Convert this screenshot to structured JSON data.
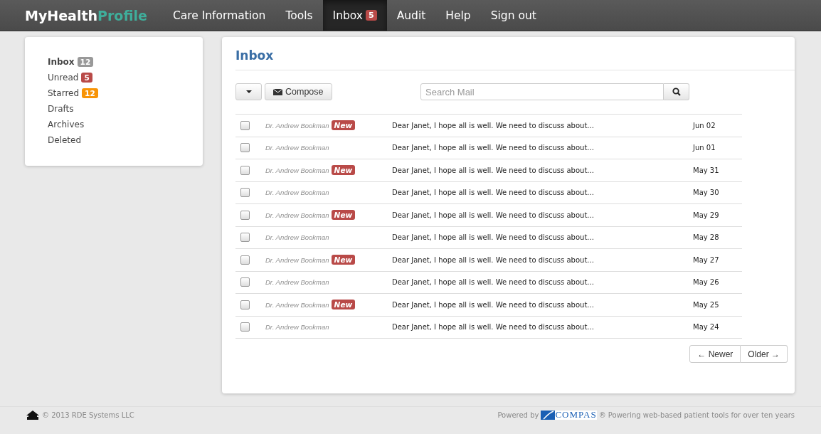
{
  "navbar": {
    "brand": {
      "first": "MyHealth",
      "second": "Profile"
    },
    "items": [
      {
        "label": "Care Information",
        "selected": false
      },
      {
        "label": "Tools",
        "selected": false
      },
      {
        "label": "Inbox",
        "badge": "5",
        "selected": true
      },
      {
        "label": "Audit",
        "selected": false
      },
      {
        "label": "Help",
        "selected": false
      },
      {
        "label": "Sign out",
        "selected": false
      }
    ]
  },
  "sidebar": {
    "items": [
      {
        "label": "Inbox",
        "badge": "12",
        "color": "#999999",
        "selected": true
      },
      {
        "label": "Unread",
        "badge": "5",
        "color": "#b94a48",
        "selected": false
      },
      {
        "label": "Starred",
        "badge": "12",
        "color": "#f89406",
        "selected": false
      },
      {
        "label": "Drafts",
        "selected": false
      },
      {
        "label": "Archives",
        "selected": false
      },
      {
        "label": "Deleted",
        "selected": false
      }
    ]
  },
  "inbox": {
    "title": "Inbox",
    "compose": "Compose",
    "search": {
      "placeholder": "Search Mail"
    },
    "messages": [
      {
        "sender": "Dr. Andrew Bookman",
        "new": true,
        "badge": "New",
        "subject": "Dear Janet, I hope all is well. We need to discuss about...",
        "date": "Jun 02",
        "checked": false
      },
      {
        "sender": "Dr. Andrew Bookman",
        "new": false,
        "subject": "Dear Janet, I hope all is well. We need to discuss about...",
        "date": "Jun 01",
        "checked": false
      },
      {
        "sender": "Dr. Andrew Bookman",
        "new": true,
        "badge": "New",
        "subject": "Dear Janet, I hope all is well. We need to discuss about...",
        "date": "May 31",
        "checked": false
      },
      {
        "sender": "Dr. Andrew Bookman",
        "new": false,
        "subject": "Dear Janet, I hope all is well. We need to discuss about...",
        "date": "May 30",
        "checked": false
      },
      {
        "sender": "Dr. Andrew Bookman",
        "new": true,
        "badge": "New",
        "subject": "Dear Janet, I hope all is well. We need to discuss about...",
        "date": "May 29",
        "checked": false
      },
      {
        "sender": "Dr. Andrew Bookman",
        "new": false,
        "subject": "Dear Janet, I hope all is well. We need to discuss about...",
        "date": "May 28",
        "checked": false
      },
      {
        "sender": "Dr. Andrew Bookman",
        "new": true,
        "badge": "New",
        "subject": "Dear Janet, I hope all is well. We need to discuss about...",
        "date": "May 27",
        "checked": false
      },
      {
        "sender": "Dr. Andrew Bookman",
        "new": false,
        "subject": "Dear Janet, I hope all is well. We need to discuss about...",
        "date": "May 26",
        "checked": false
      },
      {
        "sender": "Dr. Andrew Bookman",
        "new": true,
        "badge": "New",
        "subject": "Dear Janet, I hope all is well. We need to discuss about...",
        "date": "May 25",
        "checked": false
      },
      {
        "sender": "Dr. Andrew Bookman",
        "new": false,
        "subject": "Dear Janet, I hope all is well. We need to discuss about...",
        "date": "May 24",
        "checked": false
      }
    ],
    "pager": {
      "newer": "← Newer",
      "older": "Older →"
    }
  },
  "footer": {
    "copyright": "© 2013 RDE Systems LLC",
    "powered_by": "Powered by",
    "logo_text": "COMPAS",
    "tagline": "® Powering web-based patient tools for over ten years"
  }
}
